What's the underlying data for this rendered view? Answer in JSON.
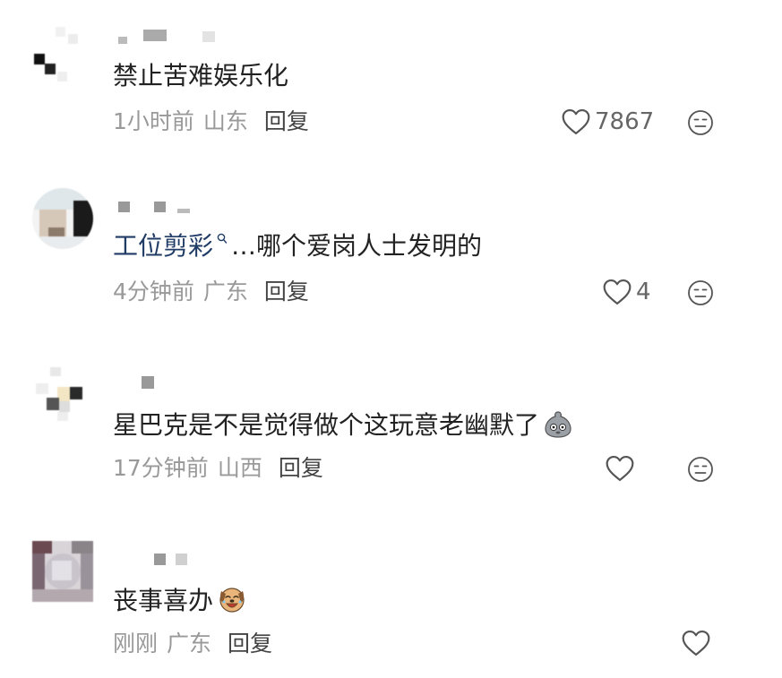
{
  "comments": [
    {
      "text": "禁止苦难娱乐化",
      "time": "1小时前",
      "region": "山东",
      "reply_label": "回复",
      "likes": "7867"
    },
    {
      "mention": "工位剪彩",
      "text": "…哪个爱岗人士发明的",
      "time": "4分钟前",
      "region": "广东",
      "reply_label": "回复",
      "likes": "4"
    },
    {
      "text": "星巴克是不是觉得做个这玩意老幽默了",
      "emoji": "grey-blob-emoji",
      "time": "17分钟前",
      "region": "山西",
      "reply_label": "回复",
      "likes": ""
    },
    {
      "text": "丧事喜办",
      "emoji": "laughing-dog-emoji",
      "time": "刚刚",
      "region": "广东",
      "reply_label": "回复",
      "likes": ""
    }
  ],
  "icons": {
    "like": "heart-outline-icon",
    "dislike": "neutral-face-icon",
    "mention_marker": "search-tag-icon"
  },
  "colors": {
    "text": "#222222",
    "meta": "#999999",
    "reply": "#444444",
    "mention": "#1f3b66",
    "icon": "#555555"
  }
}
